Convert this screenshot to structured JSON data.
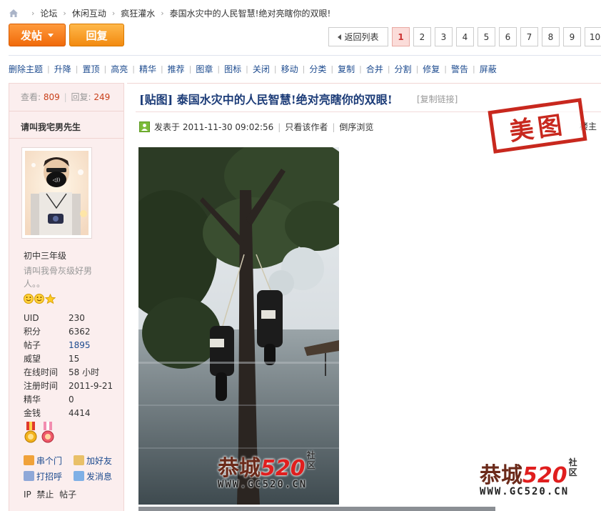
{
  "breadcrumb": {
    "items": [
      "论坛",
      "休闲互动",
      "疯狂灌水",
      "泰国水灾中的人民智慧!绝对亮瞎你的双眼!"
    ]
  },
  "toolbar": {
    "post_label": "发帖",
    "reply_label": "回复"
  },
  "pager": {
    "back_label": "返回列表",
    "pages": [
      "1",
      "2",
      "3",
      "4",
      "5",
      "6",
      "7",
      "8",
      "9",
      "10"
    ],
    "current": "1"
  },
  "moderation": {
    "items": [
      "删除主题",
      "升降",
      "置顶",
      "高亮",
      "精华",
      "推荐",
      "图章",
      "图标",
      "关闭",
      "移动",
      "分类",
      "复制",
      "合并",
      "分割",
      "修复",
      "警告",
      "屏蔽"
    ]
  },
  "thread_stats": {
    "views_label": "查看:",
    "views": "809",
    "replies_label": "回复:",
    "replies": "249"
  },
  "author": {
    "name": "请叫我宅男先生",
    "level": "初中三年级",
    "signature": "请叫我骨灰级好男人。。",
    "profile": [
      {
        "k": "UID",
        "v": "230"
      },
      {
        "k": "积分",
        "v": "6362"
      },
      {
        "k": "帖子",
        "v": "1895"
      },
      {
        "k": "威望",
        "v": "15"
      },
      {
        "k": "在线时间",
        "v": "58 小时"
      },
      {
        "k": "注册时间",
        "v": "2011-9-21"
      },
      {
        "k": "精华",
        "v": "0"
      },
      {
        "k": "金钱",
        "v": "4414"
      }
    ],
    "actions": {
      "visit": "串个门",
      "add_friend": "加好友",
      "greet": "打招呼",
      "message": "发消息",
      "ip": "IP",
      "ban": "禁止",
      "posts": "帖子"
    }
  },
  "post": {
    "title": "[贴图] 泰国水灾中的人民智慧!绝对亮瞎你的双眼!",
    "copy_link": "[复制链接]",
    "posted_label": "发表于",
    "posted_at": "2011-11-30 09:02:56",
    "only_author": "只看该作者",
    "reverse": "倒序浏览",
    "floor": "楼主",
    "stamp": "美图"
  },
  "watermark": {
    "brand": "恭城",
    "num": "520",
    "suffix_top": "社",
    "suffix_bottom": "区",
    "url": "WWW.GC520.CN"
  },
  "colors": {
    "accent_orange": "#f06a0a",
    "link_blue": "#1d4b8f",
    "title_blue": "#1c3c78",
    "stamp_red": "#c8281e",
    "sidebar_bg": "#fbeeee"
  }
}
